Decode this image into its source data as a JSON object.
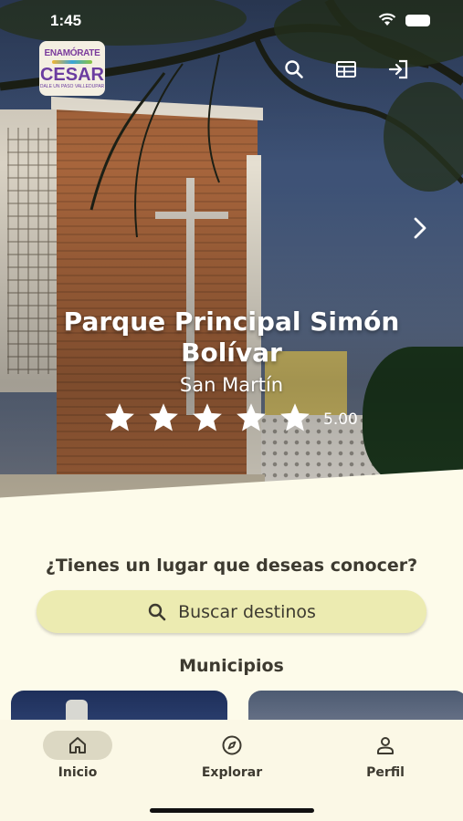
{
  "status_bar": {
    "time": "1:45"
  },
  "logo": {
    "line1": "ENAMÓRATE",
    "line2": "CESAR",
    "line3": "DALE UN PASO VALLEDUPAR"
  },
  "top_actions": [
    "search-icon",
    "calendar-icon",
    "login-icon"
  ],
  "hero": {
    "title": "Parque Principal Simón Bolívar",
    "location": "San Martín",
    "rating": "5.00",
    "stars": 5
  },
  "prompt": {
    "question": "¿Tienes un lugar que deseas conocer?",
    "search_label": "Buscar destinos"
  },
  "municipios": {
    "title": "Municipios"
  },
  "nav": {
    "items": [
      {
        "label": "Inicio",
        "icon": "home-icon",
        "active": true
      },
      {
        "label": "Explorar",
        "icon": "compass-icon",
        "active": false
      },
      {
        "label": "Perfil",
        "icon": "person-icon",
        "active": false
      }
    ]
  },
  "colors": {
    "background": "#fdfbea",
    "search_button": "#ecebb1",
    "nav_active": "#dcd8c3",
    "text": "#3d3a30"
  }
}
